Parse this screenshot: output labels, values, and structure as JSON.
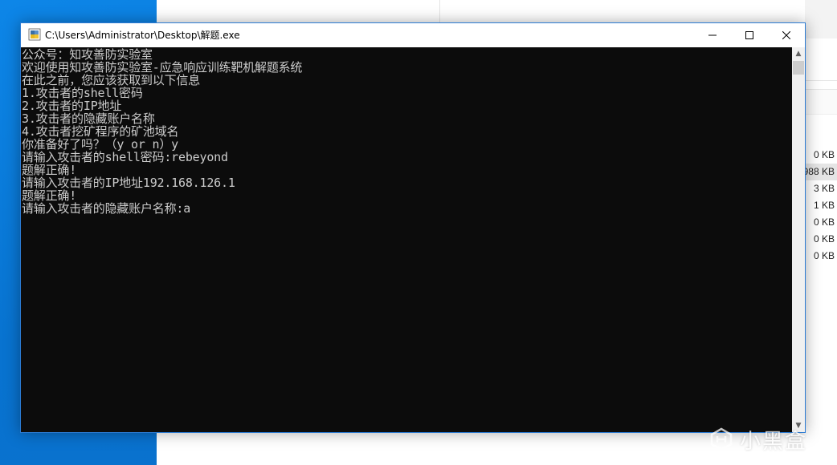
{
  "window": {
    "title": "C:\\Users\\Administrator\\Desktop\\解题.exe"
  },
  "controls": {
    "minimize": "—",
    "maximize": "☐",
    "close": "✕"
  },
  "console": {
    "lines": [
      "公众号：知攻善防实验室",
      "欢迎使用知攻善防实验室-应急响应训练靶机解题系统",
      "在此之前，您应该获取到以下信息",
      "1.攻击者的shell密码",
      "2.攻击者的IP地址",
      "3.攻击者的隐藏账户名称",
      "4.攻击者挖矿程序的矿池域名",
      "你准备好了吗？（y or n）y",
      "请输入攻击者的shell密码:rebeyond",
      "题解正确!",
      "请输入攻击者的IP地址192.168.126.1",
      "题解正确!",
      "请输入攻击者的隐藏账户名称:a"
    ]
  },
  "explorer": {
    "sizes": [
      "0 KB",
      "988 KB",
      "3 KB",
      "1 KB",
      "0 KB",
      "0 KB",
      "0 KB"
    ]
  },
  "watermark": {
    "text": "小黑盒"
  },
  "colors": {
    "console_bg": "#0c0c0c",
    "console_text": "#cccccc",
    "desktop": "#0a78d4"
  }
}
